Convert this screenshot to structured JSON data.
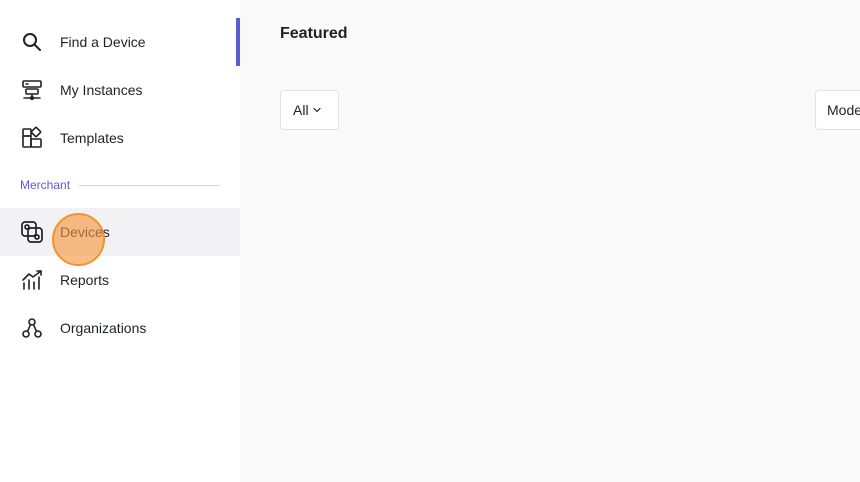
{
  "sidebar": {
    "items": [
      {
        "label": "Find a Device",
        "icon": "search-icon"
      },
      {
        "label": "My Instances",
        "icon": "server-network-icon"
      },
      {
        "label": "Templates",
        "icon": "templates-icon"
      },
      {
        "label": "Devices",
        "icon": "devices-link-icon",
        "active": true
      },
      {
        "label": "Reports",
        "icon": "chart-trend-icon"
      },
      {
        "label": "Organizations",
        "icon": "org-hierarchy-icon"
      }
    ],
    "section_label": "Merchant"
  },
  "main": {
    "title": "Featured",
    "filter": {
      "label": "All"
    },
    "model_dropdown": {
      "label": "Mode"
    }
  },
  "colors": {
    "accent": "#5b5bd6",
    "active_bg": "#f2f2f4",
    "click_highlight": "#f0942f"
  }
}
